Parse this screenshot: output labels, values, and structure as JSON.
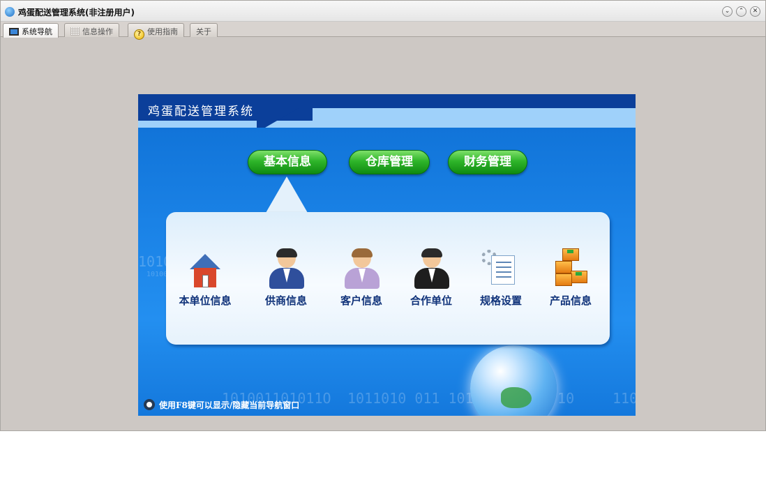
{
  "window": {
    "title": "鸡蛋配送管理系统(非注册用户)",
    "controls": [
      "⌄",
      "⌃",
      "✕"
    ]
  },
  "tabs": [
    {
      "label": "系统导航",
      "icon": "monitor-icon",
      "active": true
    },
    {
      "label": "信息操作",
      "icon": "grid-icon",
      "active": false
    },
    {
      "label": "使用指南",
      "icon": "help-icon",
      "active": false
    },
    {
      "label": "关于",
      "icon": "",
      "active": false
    }
  ],
  "panel": {
    "title": "鸡蛋配送管理系统",
    "nav_buttons": [
      "基本信息",
      "仓库管理",
      "财务管理"
    ],
    "items": [
      {
        "label": "本单位信息",
        "icon": "house-icon"
      },
      {
        "label": "供商信息",
        "icon": "supplier-person-icon"
      },
      {
        "label": "客户信息",
        "icon": "customer-person-icon"
      },
      {
        "label": "合作单位",
        "icon": "partner-person-icon"
      },
      {
        "label": "规格设置",
        "icon": "settings-document-icon"
      },
      {
        "label": "产品信息",
        "icon": "product-boxes-icon"
      }
    ],
    "footer_hint": "使用F8键可以显示/隐藏当前导航窗口",
    "binary_texts": [
      "1010",
      "10100",
      "101001101011O",
      "1011010  011  101101101010  10",
      "110"
    ]
  },
  "colors": {
    "accent_green": "#2fb52a",
    "panel_blue": "#1a82e6",
    "header_dark": "#0b3f9a",
    "label_navy": "#10337a"
  }
}
